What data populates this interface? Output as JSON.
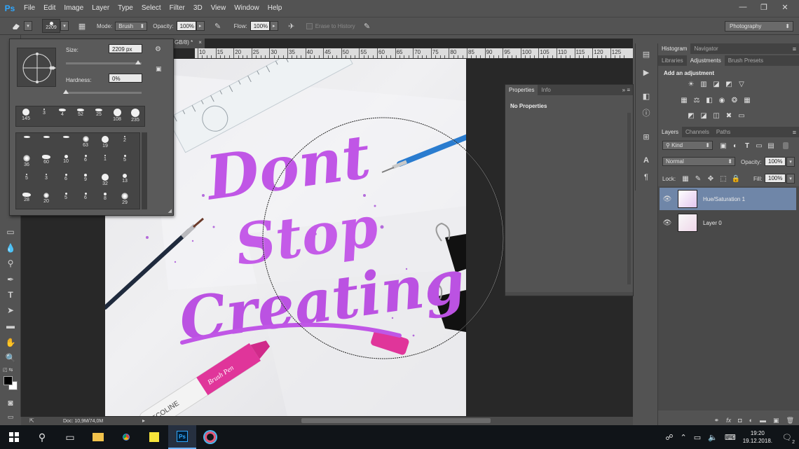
{
  "app": {
    "logo": "Ps"
  },
  "menu": [
    "File",
    "Edit",
    "Image",
    "Layer",
    "Type",
    "Select",
    "Filter",
    "3D",
    "View",
    "Window",
    "Help"
  ],
  "window_controls": {
    "minimize": "—",
    "maximize": "❐",
    "close": "✕"
  },
  "options_bar": {
    "brush_size": "2209",
    "mode_label": "Mode:",
    "mode_value": "Brush",
    "opacity_label": "Opacity:",
    "opacity_value": "100%",
    "flow_label": "Flow:",
    "flow_value": "100%",
    "erase_history_label": "Erase to History",
    "workspace": "Photography"
  },
  "document": {
    "tab_title": "GB/8) *",
    "tab_close": "×",
    "status": "Doc: 10,9M/74,0M",
    "ruler_labels": [
      "10",
      "15",
      "20",
      "25",
      "30",
      "35",
      "40",
      "45",
      "50",
      "55",
      "60",
      "65",
      "70",
      "75",
      "80",
      "85",
      "90",
      "95",
      "100",
      "105",
      "110",
      "115",
      "120",
      "125"
    ]
  },
  "artwork": {
    "line1": "Dont",
    "line2": "Stop",
    "line3": "Creating",
    "marker_brand": "ECOLINE",
    "marker_script": "Brush Pen"
  },
  "brush_popup": {
    "size_label": "Size:",
    "size_value": "2209 px",
    "hardness_label": "Hardness:",
    "hardness_value": "0%",
    "size_fraction": 0.95,
    "hardness_fraction": 0.0,
    "top_row": [
      {
        "n": "145",
        "kind": "round",
        "s": 10
      },
      {
        "n": "3",
        "kind": "round",
        "s": 2
      },
      {
        "n": "4",
        "kind": "dab",
        "s": 7
      },
      {
        "n": "52",
        "kind": "dab",
        "s": 7
      },
      {
        "n": "25",
        "kind": "dab",
        "s": 7
      },
      {
        "n": "108",
        "kind": "round",
        "s": 11
      },
      {
        "n": "235",
        "kind": "round",
        "s": 12
      }
    ],
    "grid_rows": [
      [
        {
          "n": "",
          "kind": "dab",
          "s": 6
        },
        {
          "n": "",
          "kind": "dab",
          "s": 6
        },
        {
          "n": "",
          "kind": "dab",
          "s": 6
        },
        {
          "n": "63",
          "kind": "tex",
          "s": 9
        },
        {
          "n": "19",
          "kind": "round",
          "s": 10
        },
        {
          "n": "2",
          "kind": "round",
          "s": 2
        }
      ],
      [
        {
          "n": "36",
          "kind": "tex",
          "s": 10
        },
        {
          "n": "60",
          "kind": "dab",
          "s": 9
        },
        {
          "n": "10",
          "kind": "round",
          "s": 5
        },
        {
          "n": "6",
          "kind": "round",
          "s": 3
        },
        {
          "n": "1",
          "kind": "round",
          "s": 2
        },
        {
          "n": "5",
          "kind": "round",
          "s": 3
        }
      ],
      [
        {
          "n": "5",
          "kind": "round",
          "s": 2
        },
        {
          "n": "3",
          "kind": "round",
          "s": 2
        },
        {
          "n": "6",
          "kind": "round",
          "s": 3
        },
        {
          "n": "9",
          "kind": "round",
          "s": 4
        },
        {
          "n": "32",
          "kind": "round",
          "s": 10
        },
        {
          "n": "13",
          "kind": "round",
          "s": 6
        }
      ],
      [
        {
          "n": "28",
          "kind": "dab",
          "s": 9
        },
        {
          "n": "20",
          "kind": "tex",
          "s": 8
        },
        {
          "n": "5",
          "kind": "round",
          "s": 3
        },
        {
          "n": "6",
          "kind": "round",
          "s": 3
        },
        {
          "n": "8",
          "kind": "round",
          "s": 4
        },
        {
          "n": "29",
          "kind": "tex",
          "s": 10
        }
      ]
    ]
  },
  "properties_panel": {
    "tabs": [
      "Properties",
      "Info"
    ],
    "title": "No Properties"
  },
  "right_dock": {
    "top_tabs": [
      "Histogram",
      "Navigator"
    ],
    "mid_tabs": [
      "Libraries",
      "Adjustments",
      "Brush Presets"
    ],
    "adjustments_title": "Add an adjustment",
    "layer_tabs": [
      "Layers",
      "Channels",
      "Paths"
    ],
    "kind_filter": "Kind",
    "blend_mode": "Normal",
    "opacity_label": "Opacity:",
    "opacity_value": "100%",
    "lock_label": "Lock:",
    "fill_label": "Fill:",
    "fill_value": "100%",
    "layers": [
      {
        "name": "Hue/Saturation 1",
        "selected": true
      },
      {
        "name": "Layer 0",
        "selected": false
      }
    ]
  },
  "taskbar": {
    "time": "19:20",
    "date": "19.12.2018.",
    "notifications": "2"
  },
  "colors": {
    "ps_blue": "#31a8ff",
    "lettering": "#c056e6",
    "marker_pink": "#e0359a",
    "pen_blue": "#2a7ccf",
    "selected_layer": "#6f86a8"
  }
}
